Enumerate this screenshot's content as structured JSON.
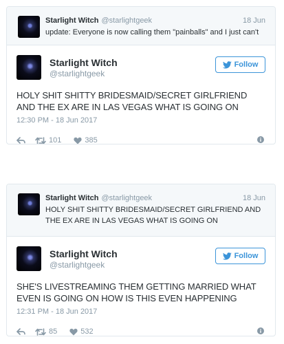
{
  "tweets": [
    {
      "parent": {
        "name": "Starlight Witch",
        "handle": "@starlightgeek",
        "date": "18 Jun",
        "text": "update: Everyone is now calling them \"painballs\" and I just can't"
      },
      "main": {
        "name": "Starlight Witch",
        "handle": "@starlightgeek",
        "follow_label": "Follow",
        "text": "HOLY SHIT SHITTY BRIDESMAID/SECRET GIRLFRIEND AND THE EX ARE IN LAS VEGAS WHAT IS GOING ON",
        "time": "12:30 PM - 18 Jun 2017",
        "retweets": "101",
        "likes": "385"
      }
    },
    {
      "parent": {
        "name": "Starlight Witch",
        "handle": "@starlightgeek",
        "date": "18 Jun",
        "text": "HOLY SHIT SHITTY BRIDESMAID/SECRET GIRLFRIEND AND THE EX ARE IN LAS VEGAS WHAT IS GOING ON"
      },
      "main": {
        "name": "Starlight Witch",
        "handle": "@starlightgeek",
        "follow_label": "Follow",
        "text": "SHE'S LIVESTREAMING THEM GETTING MARRIED WHAT EVEN IS GOING ON HOW IS THIS EVEN HAPPENING",
        "time": "12:31 PM - 18 Jun 2017",
        "retweets": "85",
        "likes": "532"
      }
    }
  ],
  "colors": {
    "accent": "#3b94d9",
    "muted": "#8899a6",
    "text": "#292f33",
    "border": "#e1e8ed",
    "parent_bg": "#f5f8fa"
  },
  "icons": {
    "follow": "twitter-bird-icon",
    "reply": "reply-icon",
    "retweet": "retweet-icon",
    "like": "heart-icon",
    "info": "info-icon"
  }
}
